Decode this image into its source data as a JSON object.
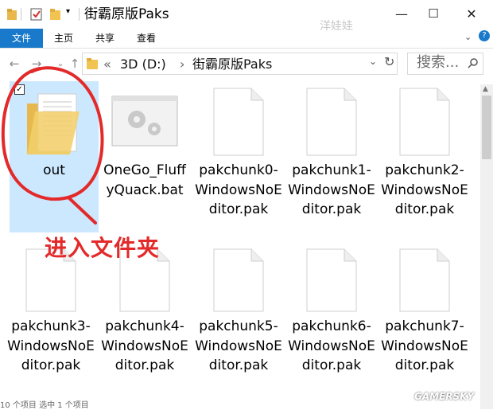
{
  "window": {
    "title": "街霸原版Paks",
    "watermark": "洋娃娃",
    "controls": {
      "minimize": "—",
      "maximize": "☐",
      "close": "✕"
    }
  },
  "ribbon": {
    "tabs": [
      "文件",
      "主页",
      "共享",
      "查看"
    ]
  },
  "address": {
    "overflow": "«",
    "drive": "3D (D:)",
    "separator": "›",
    "folder": "街霸原版Paks",
    "refresh": "↻",
    "search_placeholder": "搜索..."
  },
  "items": [
    {
      "name": "out",
      "type": "folder",
      "selected": true
    },
    {
      "name": "OneGo_FluffyQuack.bat",
      "type": "bat"
    },
    {
      "name": "pakchunk0-WindowsNoEditor.pak",
      "type": "pak"
    },
    {
      "name": "pakchunk1-WindowsNoEditor.pak",
      "type": "pak"
    },
    {
      "name": "pakchunk2-WindowsNoEditor.pak",
      "type": "pak"
    },
    {
      "name": "pakchunk3-WindowsNoEditor.pak",
      "type": "pak"
    },
    {
      "name": "pakchunk4-WindowsNoEditor.pak",
      "type": "pak"
    },
    {
      "name": "pakchunk5-WindowsNoEditor.pak",
      "type": "pak"
    },
    {
      "name": "pakchunk6-WindowsNoEditor.pak",
      "type": "pak"
    },
    {
      "name": "pakchunk7-WindowsNoEditor.pak",
      "type": "pak"
    }
  ],
  "annotation": {
    "text": "进入文件夹",
    "color": "#e32a2a"
  },
  "status": {
    "text": "10 个项目    选中 1 个项目"
  },
  "brand": "GAMERSKY",
  "colors": {
    "accent": "#1979ca",
    "selection": "#cce8ff"
  }
}
